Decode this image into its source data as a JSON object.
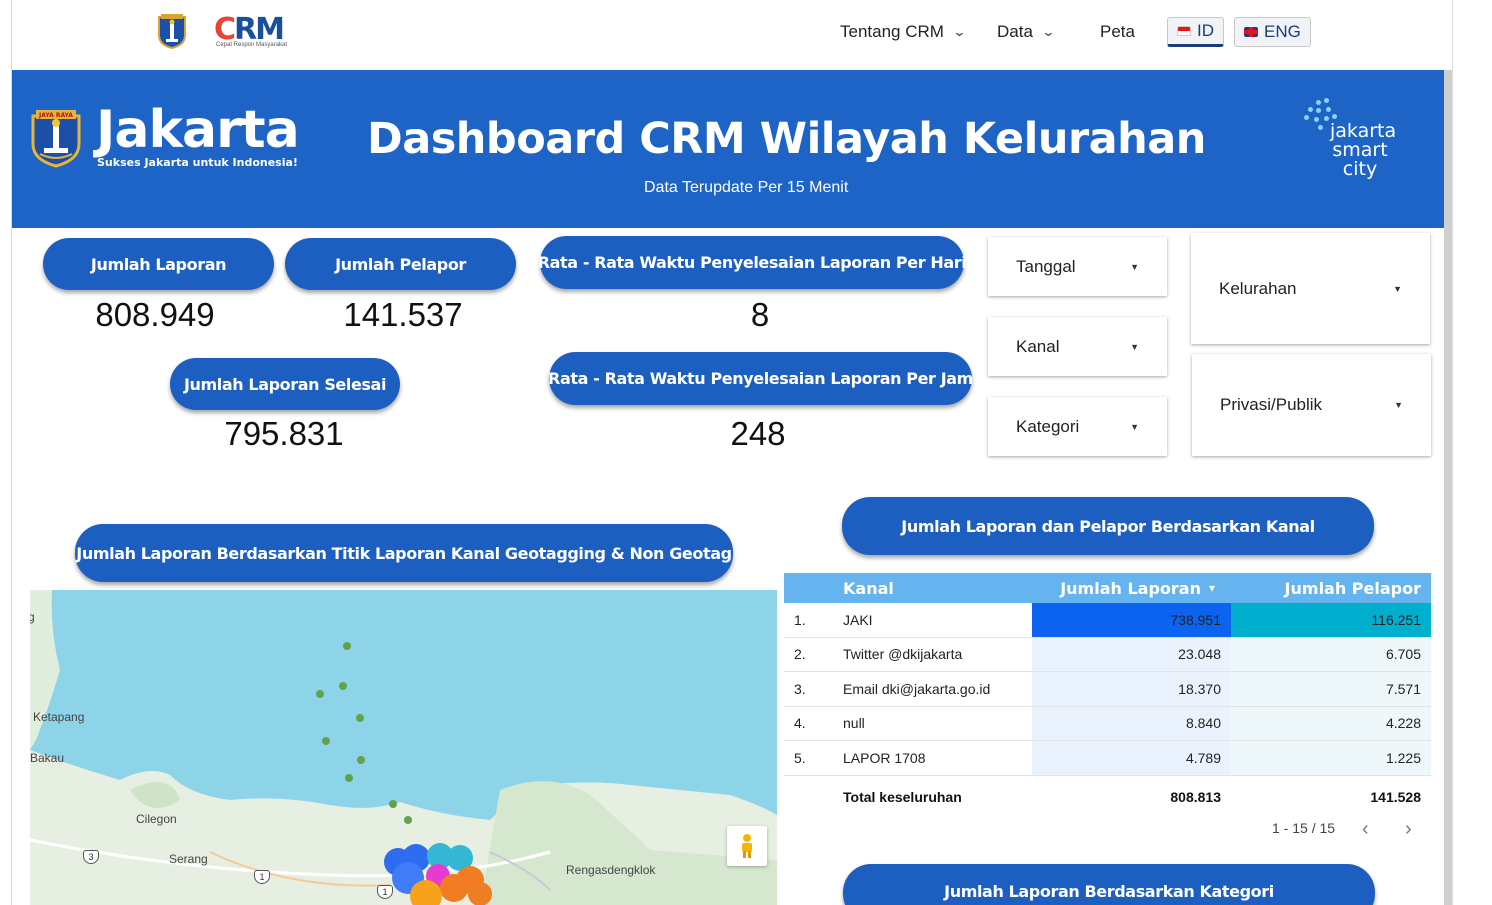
{
  "nav": {
    "about": "Tentang CRM",
    "data": "Data",
    "map": "Peta",
    "lang_id": "ID",
    "lang_en": "ENG",
    "crm_logo": "CRM",
    "crm_tagline": "Cepat Respon Masyarakat"
  },
  "banner": {
    "brand": "Jakarta",
    "brand_tagline": "Sukses Jakarta untuk Indonesia!",
    "title": "Dashboard CRM Wilayah Kelurahan",
    "subtitle": "Data Terupdate Per 15 Menit",
    "partner_logo": "jakarta smart city",
    "crest_text": "JAYA RAYA"
  },
  "metrics": {
    "total_reports_label": "Jumlah Laporan",
    "total_reports_value": "808.949",
    "total_reporters_label": "Jumlah Pelapor",
    "total_reporters_value": "141.537",
    "completed_label": "Jumlah Laporan Selesai",
    "completed_value": "795.831",
    "avg_day_label": "Rata - Rata Waktu Penyelesaian Laporan Per Hari",
    "avg_day_value": "8",
    "avg_hour_label": "Rata - Rata Waktu Penyelesaian Laporan Per Jam",
    "avg_hour_value": "248"
  },
  "filters": {
    "date": "Tanggal",
    "channel": "Kanal",
    "category": "Kategori",
    "village": "Kelurahan",
    "privacy": "Privasi/Publik"
  },
  "map_section": {
    "title": "Jumlah Laporan Berdasarkan Titik Laporan Kanal Geotagging & Non Geotag",
    "labels": [
      "Ketapang",
      "Bakau",
      "Cilegon",
      "Serang",
      "Rengasdengklok",
      "g"
    ],
    "road_numbers": [
      "3",
      "1",
      "1"
    ]
  },
  "table_section": {
    "title": "Jumlah Laporan dan Pelapor Berdasarkan Kanal",
    "columns": [
      "Kanal",
      "Jumlah Laporan",
      "Jumlah Pelapor"
    ],
    "rows": [
      {
        "no": "1.",
        "kanal": "JAKI",
        "laporan": "738.951",
        "pelapor": "116.251"
      },
      {
        "no": "2.",
        "kanal": "Twitter @dkijakarta",
        "laporan": "23.048",
        "pelapor": "6.705"
      },
      {
        "no": "3.",
        "kanal": "Email dki@jakarta.go.id",
        "laporan": "18.370",
        "pelapor": "7.571"
      },
      {
        "no": "4.",
        "kanal": "null",
        "laporan": "8.840",
        "pelapor": "4.228"
      },
      {
        "no": "5.",
        "kanal": "LAPOR 1708",
        "laporan": "4.789",
        "pelapor": "1.225"
      }
    ],
    "total_label": "Total keseluruhan",
    "total_laporan": "808.813",
    "total_pelapor": "141.528",
    "pagination": "1 - 15 / 15",
    "sort_indicator": "▾"
  },
  "category_section": {
    "title": "Jumlah Laporan Berdasarkan Kategori"
  },
  "colors": {
    "banner": "#1d64c6",
    "pill": "#1d5fc0",
    "table_header": "#65b4f0",
    "bar_laporan": "#0b63f0",
    "bar_pelapor": "#00aecd"
  }
}
